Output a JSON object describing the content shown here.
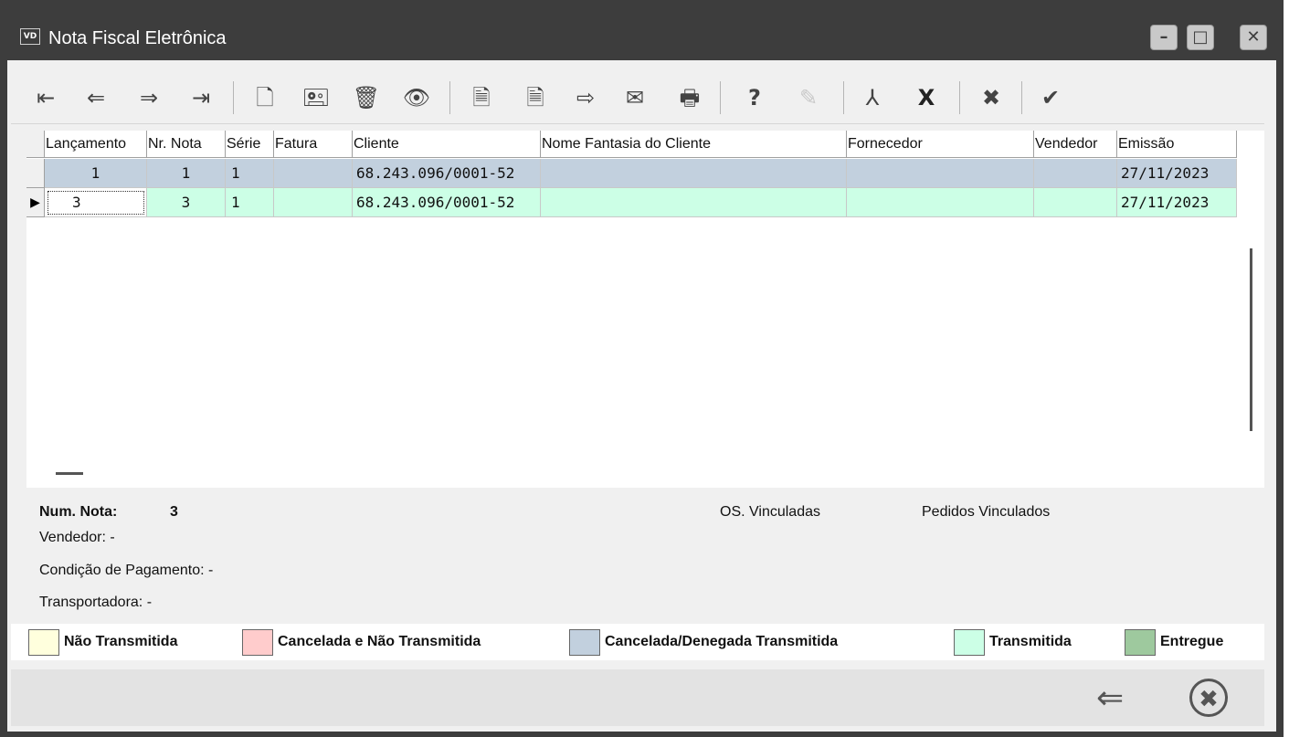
{
  "window": {
    "title": "Nota Fiscal Eletrônica",
    "app_badge": "VD",
    "min_glyph": "–",
    "max_glyph": "□",
    "close_glyph": "✕"
  },
  "toolbar": {
    "icons": [
      {
        "name": "first-record-icon",
        "glyph": "⇤"
      },
      {
        "name": "previous-record-icon",
        "glyph": "⇐"
      },
      {
        "name": "next-record-icon",
        "glyph": "⇒"
      },
      {
        "name": "last-record-icon",
        "glyph": "⇥"
      },
      {
        "name": "new-document-icon",
        "glyph": "🗋"
      },
      {
        "name": "cash-register-icon",
        "glyph": "🖭"
      },
      {
        "name": "delete-trash-icon",
        "glyph": "🗑"
      },
      {
        "name": "view-eye-icon",
        "glyph": "👁"
      },
      {
        "name": "cancel-document-icon",
        "glyph": "🗎"
      },
      {
        "name": "document-sync-icon",
        "glyph": "🗎"
      },
      {
        "name": "transmit-icon",
        "glyph": "⇨"
      },
      {
        "name": "email-icon",
        "glyph": "✉"
      },
      {
        "name": "print-icon",
        "glyph": "🖶"
      },
      {
        "name": "help-icon",
        "glyph": "?"
      },
      {
        "name": "edit-disabled-icon",
        "glyph": "✎"
      },
      {
        "name": "pdf-icon",
        "glyph": "⅄"
      },
      {
        "name": "xml-export-icon",
        "glyph": "X"
      },
      {
        "name": "cancel-circle-icon",
        "glyph": "✖"
      },
      {
        "name": "confirm-check-icon",
        "glyph": "✔"
      }
    ]
  },
  "grid": {
    "columns": [
      "Lançamento",
      "Nr. Nota",
      "Série",
      "Fatura",
      "Cliente",
      "Nome Fantasia do Cliente",
      "Fornecedor",
      "Vendedor",
      "Emissão"
    ],
    "rows": [
      {
        "lancamento": "1",
        "nr_nota": "1",
        "serie": "1",
        "fatura": "",
        "cliente": "68.243.096/0001-52",
        "fantasia": "",
        "fornecedor": "",
        "vendedor": "",
        "emissao": "27/11/2023"
      },
      {
        "lancamento": "3",
        "nr_nota": "3",
        "serie": "1",
        "fatura": "",
        "cliente": "68.243.096/0001-52",
        "fantasia": "",
        "fornecedor": "",
        "vendedor": "",
        "emissao": "27/11/2023"
      }
    ],
    "row_colors": [
      "#c2d0de",
      "#ccffe6"
    ],
    "current_row_marker": "▶"
  },
  "details": {
    "num_nota_label": "Num. Nota:",
    "num_nota_value": "3",
    "vendedor": "Vendedor: -",
    "condicao_pagamento": "Condição de Pagamento: -",
    "transportadora": "Transportadora: -",
    "os_vinculadas": "OS. Vinculadas",
    "pedidos_vinculados": "Pedidos Vinculados"
  },
  "legend": [
    {
      "label": "Não Transmitida",
      "color": "#ffffdd"
    },
    {
      "label": "Cancelada e Não Transmitida",
      "color": "#ffcccc"
    },
    {
      "label": "Cancelada/Denegada Transmitida",
      "color": "#c2d0de"
    },
    {
      "label": "Transmitida",
      "color": "#ccffe6"
    },
    {
      "label": "Entregue",
      "color": "#9ec99e"
    }
  ],
  "footer": {
    "back_glyph": "⇐",
    "close_glyph": "✖"
  }
}
